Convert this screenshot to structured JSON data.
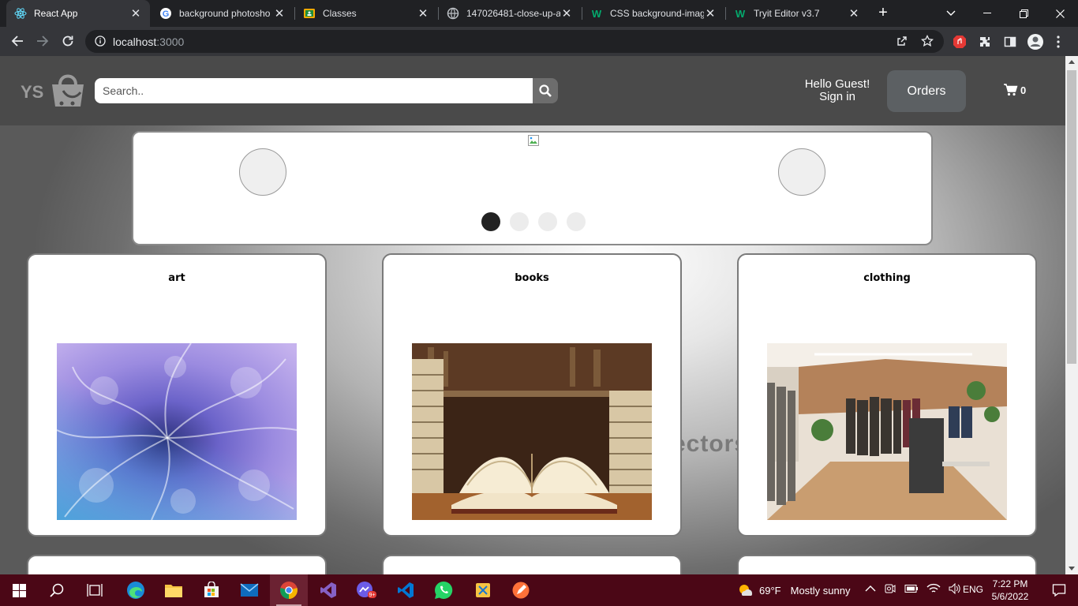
{
  "browser": {
    "tabs": [
      {
        "title": "React App",
        "active": true
      },
      {
        "title": "background photosho",
        "active": false
      },
      {
        "title": "Classes",
        "active": false
      },
      {
        "title": "147026481-close-up-a",
        "active": false
      },
      {
        "title": "CSS background-imag",
        "active": false
      },
      {
        "title": "Tryit Editor v3.7",
        "active": false
      }
    ],
    "url_host": "localhost",
    "url_port": ":3000"
  },
  "site": {
    "logo_text": "YS",
    "search_placeholder": "Search..",
    "greeting_line1": "Hello Guest!",
    "greeting_line2": "Sign in",
    "orders_label": "Orders",
    "cart_count": "0",
    "background_text": "ectors"
  },
  "carousel": {
    "slides": 4,
    "active_slide": 1
  },
  "categories": [
    {
      "name": "art"
    },
    {
      "name": "books"
    },
    {
      "name": "clothing"
    }
  ],
  "taskbar": {
    "weather": "69°F",
    "weather_desc": "Mostly sunny",
    "language": "ENG",
    "time": "7:22 PM",
    "date": "5/6/2022",
    "badge": "9+"
  },
  "colors": {
    "header_bg": "#4a4a4a",
    "orders_bg": "#5c6063",
    "taskbar_bg": "#4b0716",
    "chrome_bg": "#202124"
  }
}
